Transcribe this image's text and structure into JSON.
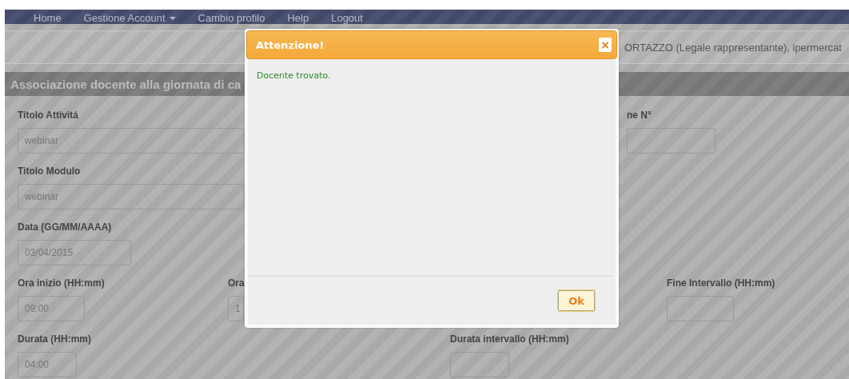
{
  "navbar": {
    "items": [
      {
        "label": "Home",
        "dropdown": false
      },
      {
        "label": "Gestione Account",
        "dropdown": true
      },
      {
        "label": "Cambio profilo",
        "dropdown": false
      },
      {
        "label": "Help",
        "dropdown": false
      },
      {
        "label": "Logout",
        "dropdown": false
      }
    ]
  },
  "user_info": "ORTAZZO (Legale rappresentante), ipermercat",
  "section_title": "Associazione docente alla giornata di ca",
  "form_rows": [
    [
      {
        "label": "Titolo Attivitá",
        "value": "webinar"
      },
      {
        "label": "ne N°"
      }
    ],
    [
      {
        "label": "Titolo Modulo",
        "value": "webinar"
      }
    ],
    [
      {
        "label": "Data (GG/MM/AAAA)",
        "value": "03/04/2015"
      }
    ],
    [
      {
        "label": "Ora inizio (HH:mm)",
        "value": "09:00"
      },
      {
        "label": "Ora",
        "value": "1"
      },
      {
        "label": "Fine Intervallo (HH:mm)"
      }
    ],
    [
      {
        "label": "Durata (HH:mm)",
        "value": "04:00"
      },
      {
        "label": "Durata intervallo (HH:mm)"
      }
    ]
  ],
  "dialog": {
    "title": "Attenzione!",
    "close_label": "×",
    "message": "Docente trovato.",
    "button": "Ok"
  }
}
